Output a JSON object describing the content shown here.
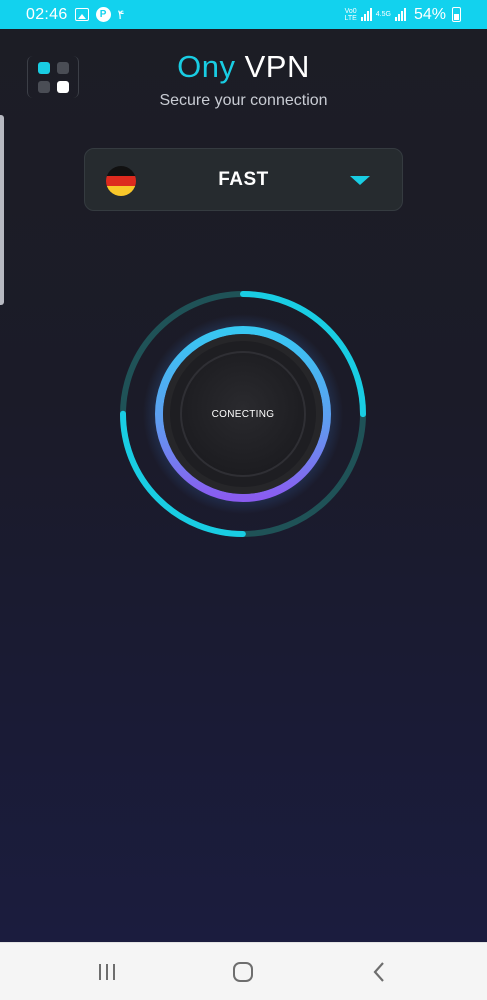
{
  "status_bar": {
    "time": "02:46",
    "extra": "۴",
    "network_label_top": "Vo0",
    "network_label_bottom": "LTE",
    "network_label2_top": "4.5G",
    "network_label2_bottom": "",
    "battery": "54%",
    "background": "#12d2ee"
  },
  "app": {
    "title_accent": "Ony",
    "title_plain": "VPN",
    "subtitle": "Secure your connection",
    "accent_color": "#19cde3",
    "server": {
      "label": "FAST",
      "flag": "germany-flag",
      "flag_colors": [
        "#111111",
        "#dd2a1e",
        "#f8c72a"
      ]
    },
    "connect": {
      "label": "CONECTING",
      "progress": 0.5
    },
    "menu_dot_colors": [
      "#19cde3",
      "#4a4d55",
      "#4a4d55",
      "#ffffff"
    ]
  },
  "nav": {
    "recents": "recents-icon",
    "home": "home-icon",
    "back": "back-icon"
  }
}
